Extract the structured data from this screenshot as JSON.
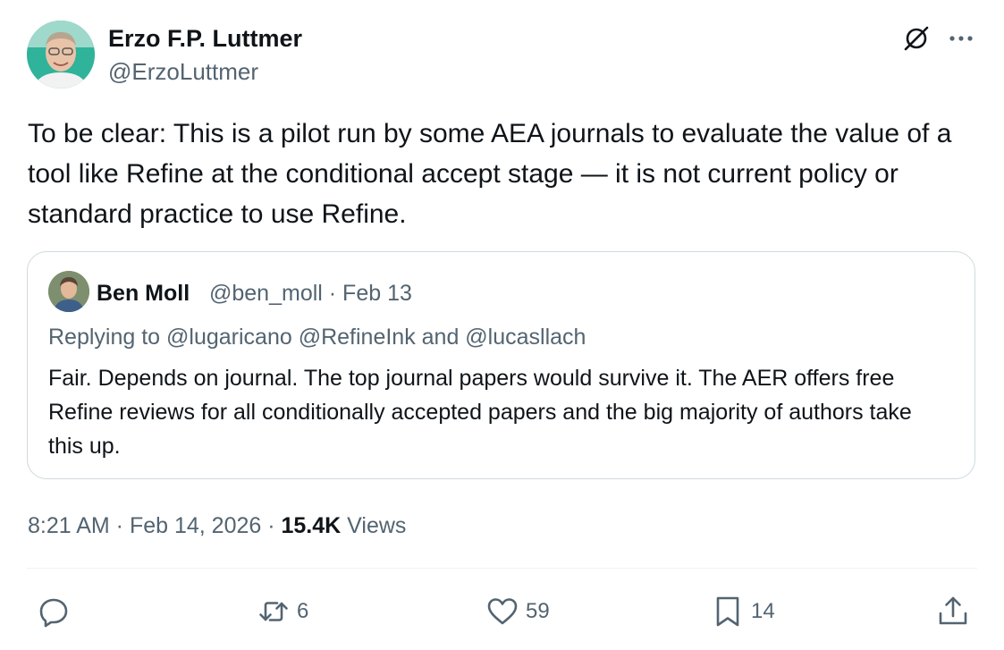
{
  "author": {
    "display_name": "Erzo F.P. Luttmer",
    "handle": "@ErzoLuttmer"
  },
  "icons": {
    "grok": "grok-icon",
    "more": "more-options-icon",
    "reply": "reply-icon",
    "retweet": "retweet-icon",
    "like": "heart-icon",
    "bookmark": "bookmark-icon",
    "share": "share-icon"
  },
  "tweet": {
    "text": "To be clear: This is a pilot run by some AEA journals to evaluate the value of a tool like Refine at the conditional accept stage — it is not current policy or standard practice to use Refine."
  },
  "quote": {
    "display_name": "Ben Moll",
    "meta": "@ben_moll · Feb 13",
    "replying_to": "Replying to @lugaricano @RefineInk and @lucasllach",
    "text": "Fair. Depends on journal. The top journal papers would survive it. The AER offers free Refine reviews for all conditionally accepted papers and the big majority of authors take this up."
  },
  "timestamp": "8:21 AM · Feb 14, 2026 · ",
  "views": {
    "count": "15.4K",
    "label": " Views"
  },
  "actions": {
    "replies": "",
    "retweets": "6",
    "likes": "59",
    "bookmarks": "14"
  },
  "colors": {
    "text": "#0f1419",
    "secondary": "#536471",
    "border": "#cfd9de"
  }
}
